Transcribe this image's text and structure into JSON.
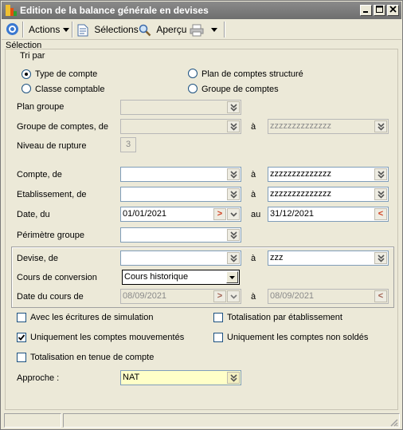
{
  "window": {
    "title": "Edition de la balance générale en devises"
  },
  "toolbar": {
    "actions_label": "Actions",
    "selections_label": "Sélections",
    "apercu_label": "Aperçu"
  },
  "section": {
    "selection": "Sélection",
    "tri_par": "Tri par"
  },
  "radios": {
    "type_compte": "Type de compte",
    "classe_comptable": "Classe comptable",
    "plan_structure": "Plan de comptes structuré",
    "groupe_comptes": "Groupe de comptes",
    "selected": "type_compte"
  },
  "labels": {
    "plan_groupe": "Plan groupe",
    "groupe_comptes_de": "Groupe de comptes, de",
    "a": "à",
    "au": "au",
    "niveau_rupture": "Niveau de rupture",
    "compte_de": "Compte, de",
    "etablissement_de": "Etablissement, de",
    "date_du": "Date, du",
    "perimetre_groupe": "Périmètre groupe",
    "devise_de": "Devise, de",
    "cours_conversion": "Cours de conversion",
    "date_cours_de": "Date du cours de",
    "approche": "Approche :"
  },
  "values": {
    "plan_groupe": "",
    "groupe_de": "",
    "groupe_a": "zzzzzzzzzzzzzz",
    "niveau_rupture": "3",
    "compte_de": "",
    "compte_a": "zzzzzzzzzzzzzz",
    "etab_de": "",
    "etab_a": "zzzzzzzzzzzzzz",
    "date_du": "01/01/2021",
    "date_au": "31/12/2021",
    "perimetre": "",
    "devise_de": "",
    "devise_a": "zzz",
    "cours_conversion": "Cours historique",
    "date_cours_de": "08/09/2021",
    "date_cours_a": "08/09/2021",
    "approche": "NAT"
  },
  "checkboxes": {
    "ecritures_simulation": {
      "label": "Avec les écritures de simulation",
      "checked": false
    },
    "comptes_mouvementes": {
      "label": "Uniquement les comptes mouvementés",
      "checked": true
    },
    "tenue_compte": {
      "label": "Totalisation en tenue de compte",
      "checked": false
    },
    "par_etablissement": {
      "label": "Totalisation par établissement",
      "checked": false
    },
    "non_soldes": {
      "label": "Uniquement les comptes non soldés",
      "checked": false
    }
  },
  "colors": {
    "approche_bg": "#ffffc8",
    "title_bg": "#7b7b7b"
  }
}
